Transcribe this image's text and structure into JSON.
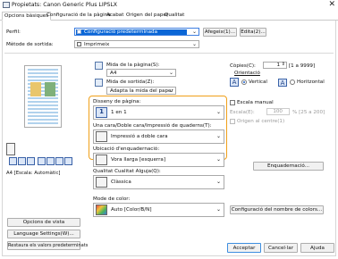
{
  "window": {
    "title": "Propietats: Canon Generic Plus LIPSLX",
    "close_glyph": "✕"
  },
  "tabs": [
    {
      "label": "Opcions bàsiques"
    },
    {
      "label": "Configuració de la pàgina"
    },
    {
      "label": "Acabat"
    },
    {
      "label": "Origen del paper"
    },
    {
      "label": "Qualitat"
    }
  ],
  "profile": {
    "label": "Perfil:",
    "value": "Configuració predeterminada",
    "add_label": "Afegeix(1)...",
    "edit_label": "Edita(2)..."
  },
  "output": {
    "label": "Mètode de sortida:",
    "value": "Imprimeix"
  },
  "page_size": {
    "label": "Mida de la pàgina(S):",
    "value": "A4"
  },
  "output_size": {
    "label": "Mida de sortida(Z):",
    "value": "Adapta la mida del paper"
  },
  "copies": {
    "label": "Còpies(C):",
    "value": "1",
    "range": "[1 a 9999]"
  },
  "orientation": {
    "label": "Orientació",
    "portrait_label": "Vertical",
    "landscape_label": "Horitzontal",
    "portrait_glyph": "A",
    "landscape_glyph": "A"
  },
  "page_layout": {
    "label": "Disseny de pàgina:",
    "value": "1 en 1",
    "icon_text": "1"
  },
  "duplex": {
    "label": "Una cara/Doble cara/Impressió de quaderns(T):",
    "value": "Impressió a doble cara"
  },
  "binding": {
    "label": "Ubicació d'enquadernació:",
    "value": "Vora llarga [esquerra]"
  },
  "manual_scale": {
    "label": "Escala manual",
    "scale_label": "Escala(E):",
    "scale_value": "100",
    "scale_range": "% [25 a 200]",
    "center_label": "Origen al centre(1)"
  },
  "binding_btn": {
    "label": "Enquadernació..."
  },
  "preview": {
    "caption": "A4 [Escala: Automàtic]"
  },
  "left_buttons": {
    "view": "Opcions de vista",
    "lang": "Language Settings(W)...",
    "restore": "Restaura els valors predeterminats"
  },
  "color_quality": {
    "label": "Qualitat Cualitat Alguja(Q):",
    "value": "Clàssica"
  },
  "color_mode": {
    "label": "Mode de color:",
    "value": "Auto [Color/B/N]",
    "settings_btn": "Configuració del nombre de colors..."
  },
  "footer": {
    "ok": "Acceptar",
    "cancel": "Cancel·lar",
    "help": "Ajuda"
  },
  "arrow_glyph": "⌄"
}
